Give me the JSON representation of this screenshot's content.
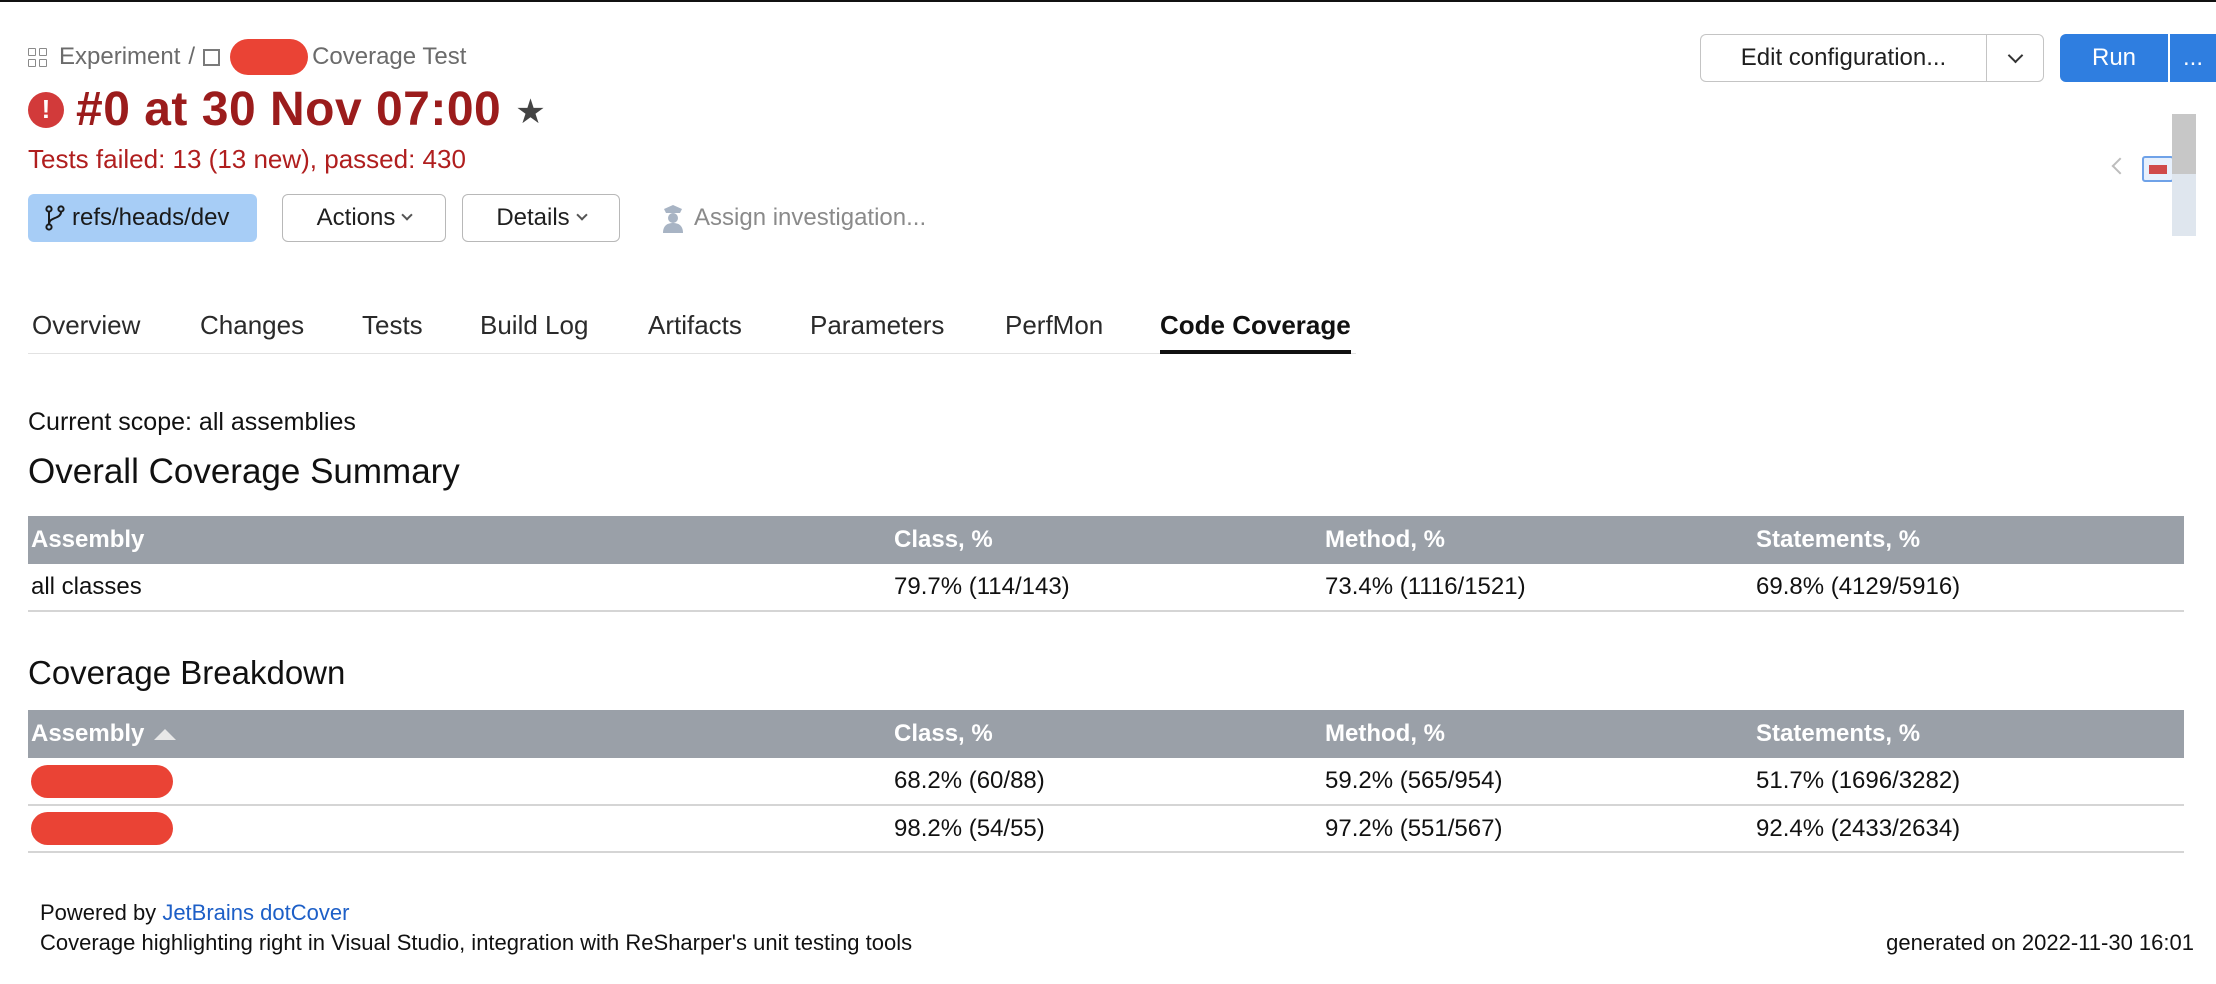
{
  "breadcrumb": {
    "project": "Experiment",
    "separator": "/",
    "build_config": "Coverage Test"
  },
  "build": {
    "title": "#0 at 30 Nov 07:00",
    "status": "Tests failed: 13 (13 new), passed: 430",
    "branch": "refs/heads/dev"
  },
  "actions": {
    "actions_label": "Actions",
    "details_label": "Details",
    "assign_label": "Assign investigation..."
  },
  "toolbar": {
    "edit_config": "Edit configuration...",
    "run": "Run",
    "more": "..."
  },
  "tabs": [
    {
      "label": "Overview"
    },
    {
      "label": "Changes"
    },
    {
      "label": "Tests"
    },
    {
      "label": "Build Log"
    },
    {
      "label": "Artifacts"
    },
    {
      "label": "Parameters"
    },
    {
      "label": "PerfMon"
    },
    {
      "label": "Code Coverage",
      "active": true
    }
  ],
  "coverage": {
    "scope": "Current scope: all assemblies",
    "summary_title": "Overall Coverage Summary",
    "headers": [
      "Assembly",
      "Class, %",
      "Method, %",
      "Statements, %"
    ],
    "summary_rows": [
      {
        "assembly": "all classes",
        "class": "79.7% (114/143)",
        "method": "73.4% (1116/1521)",
        "statements": "69.8% (4129/5916)"
      }
    ],
    "breakdown_title": "Coverage Breakdown",
    "breakdown_rows": [
      {
        "class": "68.2% (60/88)",
        "method": "59.2% (565/954)",
        "statements": "51.7% (1696/3282)"
      },
      {
        "class": "98.2% (54/55)",
        "method": "97.2% (551/567)",
        "statements": "92.4% (2433/2634)"
      }
    ]
  },
  "footer": {
    "powered_by": "Powered by",
    "powered_link": "JetBrains dotCover",
    "tagline": "Coverage highlighting right in Visual Studio, integration with ReSharper's unit testing tools",
    "generated": "generated on 2022-11-30 16:01"
  },
  "colors": {
    "accent": "#2f7ee0",
    "error": "#9b1c1c",
    "branch_bg": "#a7cdf6",
    "table_header": "#9aa0a8",
    "redaction": "#ea4335"
  }
}
